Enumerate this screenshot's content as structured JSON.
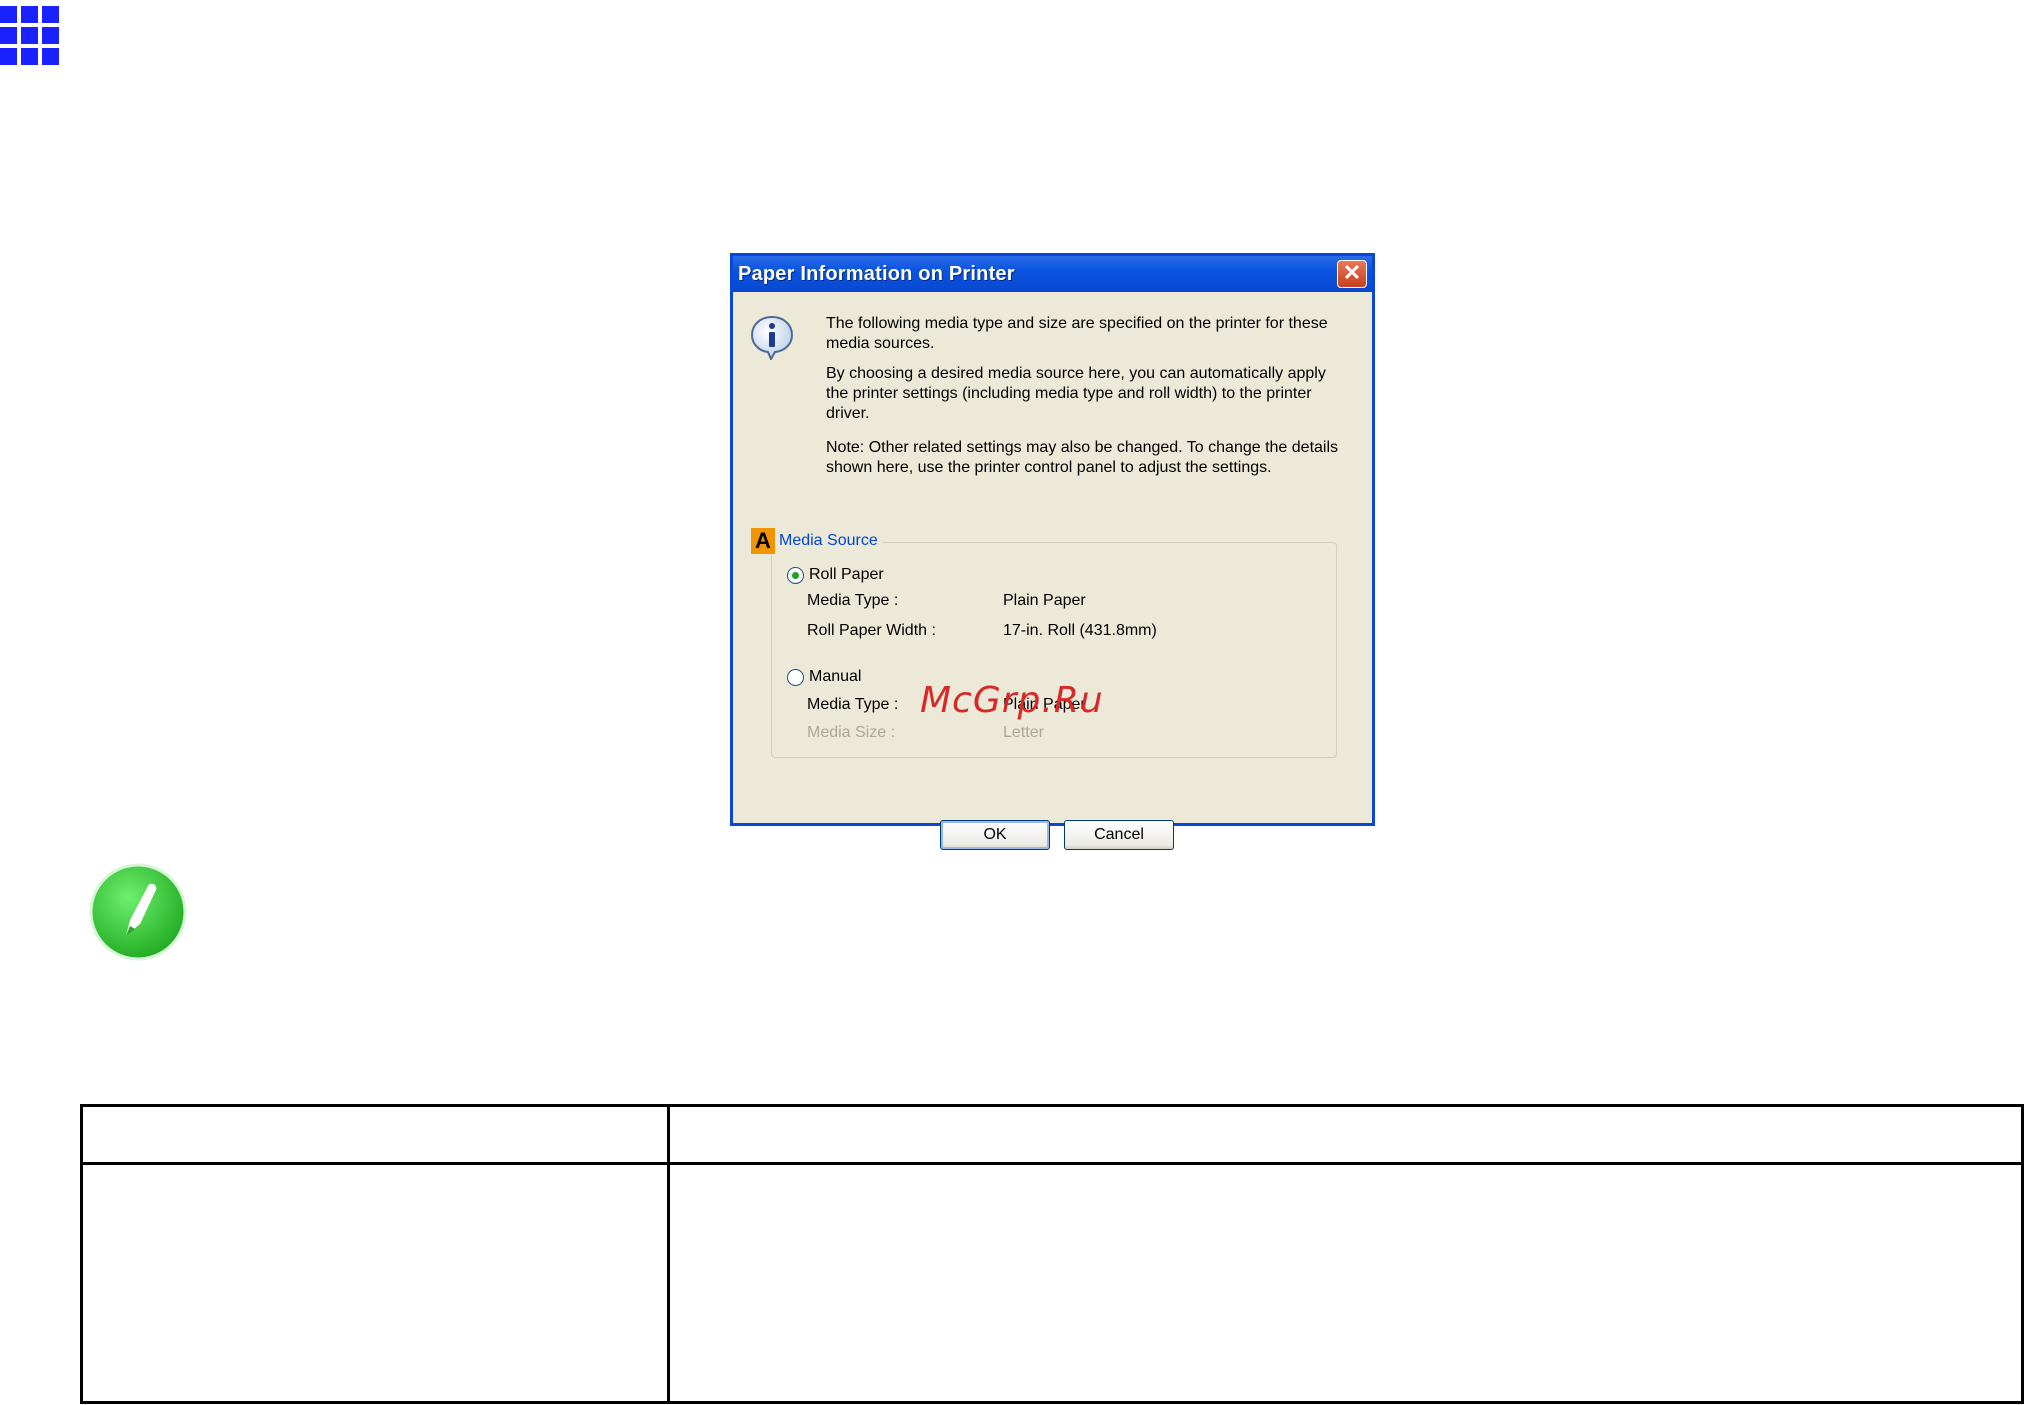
{
  "dialog": {
    "title": "Paper Information on Printer",
    "close_label": "✕",
    "message1": "The following media type and size are specified on the printer for these media sources.",
    "message2": "By choosing a desired media source here, you can automatically apply the printer settings (including media type and roll width) to the printer driver.",
    "message3": "Note: Other related settings may also be changed. To change the details shown here, use the printer control panel to adjust the settings.",
    "group_badge": "A",
    "group_title": "Media Source",
    "roll_paper": {
      "label": "Roll Paper",
      "selected": true,
      "media_type_label": "Media Type :",
      "media_type_value": "Plain Paper",
      "width_label": "Roll Paper Width :",
      "width_value": "17-in. Roll (431.8mm)"
    },
    "manual": {
      "label": "Manual",
      "selected": false,
      "media_type_label": "Media Type :",
      "media_type_value": "Plain Paper",
      "size_label": "Media Size :",
      "size_value": "Letter"
    },
    "ok_label": "OK",
    "cancel_label": "Cancel"
  },
  "watermark": "McGrp.Ru",
  "table": {
    "header": [
      "",
      ""
    ],
    "rows": [
      [
        "",
        ""
      ]
    ]
  },
  "colors": {
    "titlebar": "#0a54e0",
    "dialog_bg": "#ece9d8",
    "grid_icon": "#1a22ff",
    "note_icon": "#2ecc2e"
  },
  "icons": [
    "grid-icon",
    "info-icon",
    "close-icon",
    "note-pencil-icon"
  ]
}
